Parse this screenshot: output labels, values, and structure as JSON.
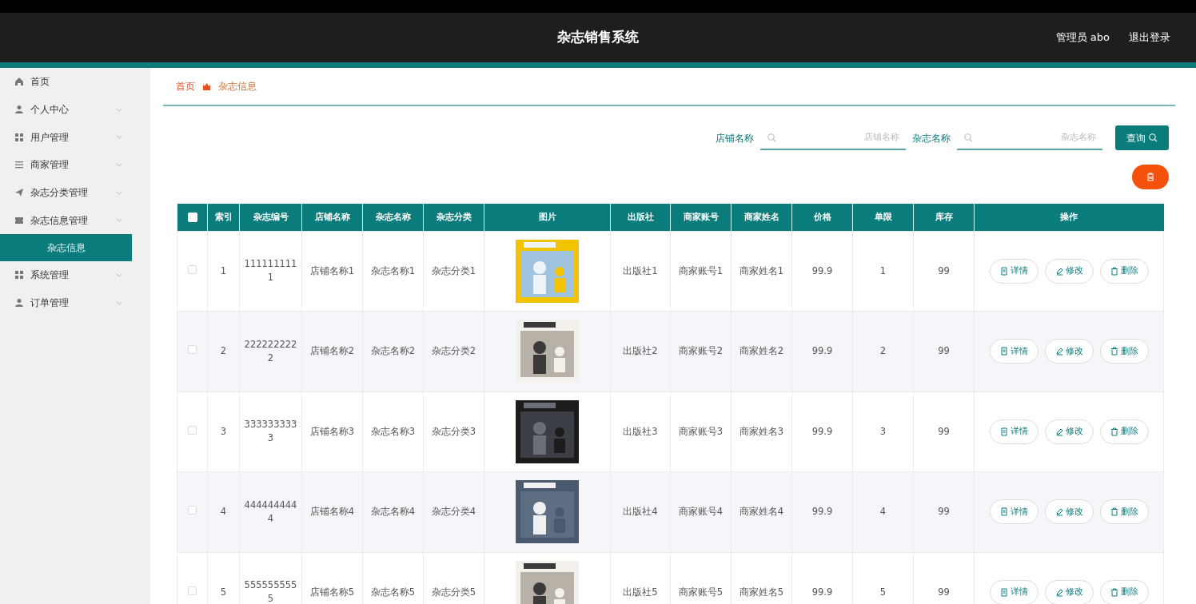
{
  "header": {
    "title": "杂志销售系统",
    "user": "管理员 abo",
    "logout": "退出登录"
  },
  "sidebar": {
    "items": [
      {
        "label": "首页",
        "expandable": false,
        "selected": false
      },
      {
        "label": "个人中心",
        "expandable": true,
        "selected": false
      },
      {
        "label": "用户管理",
        "expandable": true,
        "selected": false
      },
      {
        "label": "商家管理",
        "expandable": true,
        "selected": false
      },
      {
        "label": "杂志分类管理",
        "expandable": true,
        "selected": false
      },
      {
        "label": "杂志信息管理",
        "expandable": true,
        "selected": false,
        "children": [
          {
            "label": "杂志信息",
            "selected": true
          }
        ]
      },
      {
        "label": "系统管理",
        "expandable": true,
        "selected": false
      },
      {
        "label": "订单管理",
        "expandable": true,
        "selected": false
      }
    ]
  },
  "breadcrumb": [
    "首页",
    "杂志信息"
  ],
  "search": {
    "fields": [
      {
        "label": "店铺名称",
        "placeholder": "店铺名称"
      },
      {
        "label": "杂志名称",
        "placeholder": "杂志名称"
      }
    ],
    "button": "查询"
  },
  "table": {
    "select_all_checked": false,
    "columns": [
      "索引",
      "杂志编号",
      "店铺名称",
      "杂志名称",
      "杂志分类",
      "图片",
      "出版社",
      "商家账号",
      "商家姓名",
      "价格",
      "单限",
      "库存",
      "操作"
    ],
    "rows": [
      {
        "checked": false,
        "cells": [
          "1",
          "1111111111",
          "店铺名称1",
          "杂志名称1",
          "杂志分类1",
          {
            "kind": "picture"
          },
          "出版社1",
          "商家账号1",
          "商家姓名1",
          "99.9",
          "1",
          "99"
        ],
        "actions": [
          "详情",
          "修改",
          "删除"
        ]
      },
      {
        "checked": false,
        "cells": [
          "2",
          "2222222222",
          "店铺名称2",
          "杂志名称2",
          "杂志分类2",
          {
            "kind": "picture"
          },
          "出版社2",
          "商家账号2",
          "商家姓名2",
          "99.9",
          "2",
          "99"
        ],
        "actions": [
          "详情",
          "修改",
          "删除"
        ]
      },
      {
        "checked": false,
        "cells": [
          "3",
          "3333333333",
          "店铺名称3",
          "杂志名称3",
          "杂志分类3",
          {
            "kind": "picture"
          },
          "出版社3",
          "商家账号3",
          "商家姓名3",
          "99.9",
          "3",
          "99"
        ],
        "actions": [
          "详情",
          "修改",
          "删除"
        ]
      },
      {
        "checked": false,
        "cells": [
          "4",
          "4444444444",
          "店铺名称4",
          "杂志名称4",
          "杂志分类4",
          {
            "kind": "picture"
          },
          "出版社4",
          "商家账号4",
          "商家姓名4",
          "99.9",
          "4",
          "99"
        ],
        "actions": [
          "详情",
          "修改",
          "删除"
        ]
      },
      {
        "checked": false,
        "cells": [
          "5",
          "5555555555",
          "店铺名称5",
          "杂志名称5",
          "杂志分类5",
          {
            "kind": "picture"
          },
          "出版社5",
          "商家账号5",
          "商家姓名5",
          "99.9",
          "5",
          "99"
        ],
        "actions": [
          "详情",
          "修改",
          "删除"
        ]
      }
    ]
  }
}
